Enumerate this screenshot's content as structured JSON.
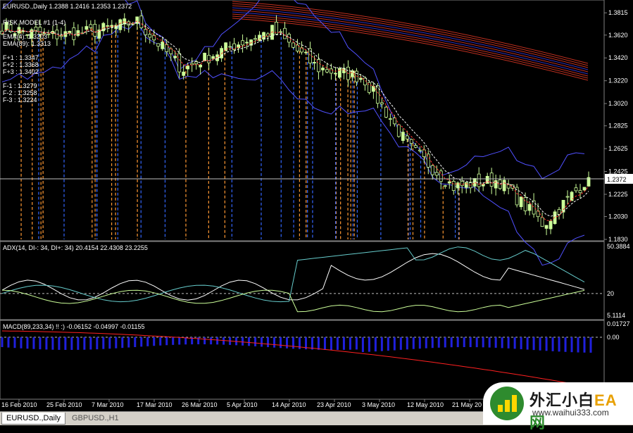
{
  "colors": {
    "background": "#000000",
    "candle_up": "#ccff99",
    "candle_down": "#000000",
    "bollinger": "#5050ff",
    "ema_a": "#ff3030",
    "ema_b": "#ffffff",
    "ribbon_red": "#c03020",
    "ribbon_blue": "#3030c0",
    "vline_orange": "#ff9933",
    "vline_blue": "#3366ff",
    "adx": "#ffffff",
    "di_minus": "#66cccc",
    "di_plus": "#ccff99",
    "macd_hist": "#2020dd",
    "macd_signal": "#ff2020",
    "price_line": "#c0c0c0"
  },
  "main": {
    "header": "EURUSD.,Daily  1.2388 1.2416 1.2353 1.2372",
    "indicator_lines": [
      "RISK MODEL #1 (1-4)",
      "",
      "EMA(4): 1.3203",
      "EMA(89): 1.3313",
      "",
      "F+1 : 1.3347",
      "F+2 : 1.3368",
      "F+3 : 1.3402",
      "",
      "F-1 : 1.3279",
      "F-2 : 1.3258",
      "F-3 : 1.3224"
    ],
    "current_price": "1.2372",
    "price_ticks": [
      "1.3815",
      "1.3620",
      "1.3420",
      "1.3220",
      "1.3020",
      "1.2825",
      "1.2625",
      "1.2425",
      "1.2225",
      "1.2030",
      "1.1830"
    ]
  },
  "adx": {
    "header": "ADX(14, DI-: 34, DI+: 34) 20.4154 22.4308 23.2255",
    "ticks": [
      "50.3884",
      "20",
      "5.1114"
    ]
  },
  "macd": {
    "header": "MACD(89,233,34)  !! :) -0.06152 -0.04997 -0.01155",
    "ticks": [
      "0.01727",
      "0.00"
    ]
  },
  "date_labels": [
    "16 Feb 2010",
    "25 Feb 2010",
    "7 Mar 2010",
    "17 Mar 2010",
    "26 Mar 2010",
    "5 Apr 2010",
    "14 Apr 2010",
    "23 Apr 2010",
    "3 May 2010",
    "12 May 2010",
    "21 May 20"
  ],
  "tabs": [
    "EURUSD.,Daily",
    "GBPUSD.,H1"
  ],
  "logo": {
    "title_a": "外汇小白",
    "title_b": "EA",
    "title_c": "网",
    "url": "www.waihui333.com"
  },
  "chart_data": [
    {
      "type": "candlestick",
      "title": "EURUSD.,Daily",
      "ylim": [
        1.183,
        1.3915
      ],
      "x": [
        "16 Feb 2010",
        "25 Feb 2010",
        "7 Mar 2010",
        "17 Mar 2010",
        "26 Mar 2010",
        "5 Apr 2010",
        "14 Apr 2010",
        "23 Apr 2010",
        "3 May 2010",
        "12 May 2010",
        "21 May 2010"
      ],
      "close_anchors": [
        1.369,
        1.361,
        1.365,
        1.374,
        1.332,
        1.351,
        1.366,
        1.333,
        1.325,
        1.265,
        1.229,
        1.235,
        1.196,
        1.2372
      ],
      "indicators": {
        "EMA(4)": 1.3203,
        "EMA(89)": 1.3313,
        "F+1": 1.3347,
        "F+2": 1.3368,
        "F+3": 1.3402,
        "F-1": 1.3279,
        "F-2": 1.3258,
        "F-3": 1.3224
      },
      "last_bar": {
        "open": 1.2388,
        "high": 1.2416,
        "low": 1.2353,
        "close": 1.2372
      }
    },
    {
      "type": "line",
      "title": "ADX(14, DI-: 34, DI+: 34)",
      "ylim": [
        5.1114,
        50.3884
      ],
      "series": [
        {
          "name": "ADX",
          "last": 20.4154
        },
        {
          "name": "DI-",
          "last": 22.4308
        },
        {
          "name": "DI+",
          "last": 23.2255
        }
      ],
      "reference_line": 20
    },
    {
      "type": "bar",
      "title": "MACD(89,233,34)",
      "series": [
        {
          "name": "MACD",
          "last": -0.06152
        },
        {
          "name": "Signal",
          "last": -0.04997
        },
        {
          "name": "Histogram",
          "last": -0.01155
        }
      ]
    }
  ]
}
